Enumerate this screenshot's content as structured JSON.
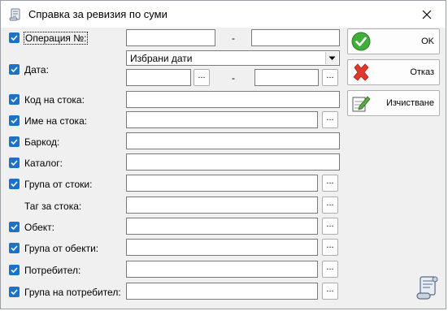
{
  "window": {
    "title": "Справка за ревизия по суми"
  },
  "fields": {
    "operation_label": "Операция №:",
    "date_label": "Дата:",
    "date_mode": "Избрани дати",
    "item_code_label": "Код на стока:",
    "item_name_label": "Име на стока:",
    "barcode_label": "Баркод:",
    "catalog_label": "Каталог:",
    "item_group_label": "Група от стоки:",
    "item_tag_label": "Таг за стока:",
    "object_label": "Обект:",
    "object_group_label": "Група от обекти:",
    "user_label": "Потребител:",
    "user_group_label": "Група на потребител:",
    "range_separator": "-",
    "browse_label": "..."
  },
  "buttons": {
    "ok_label": "OK",
    "cancel_label": "Отказ",
    "clear_label": "Изчистване"
  },
  "colors": {
    "checkbox": "#1a73c9",
    "ok_green": "#3fae3a",
    "cancel_red": "#e0392b"
  }
}
